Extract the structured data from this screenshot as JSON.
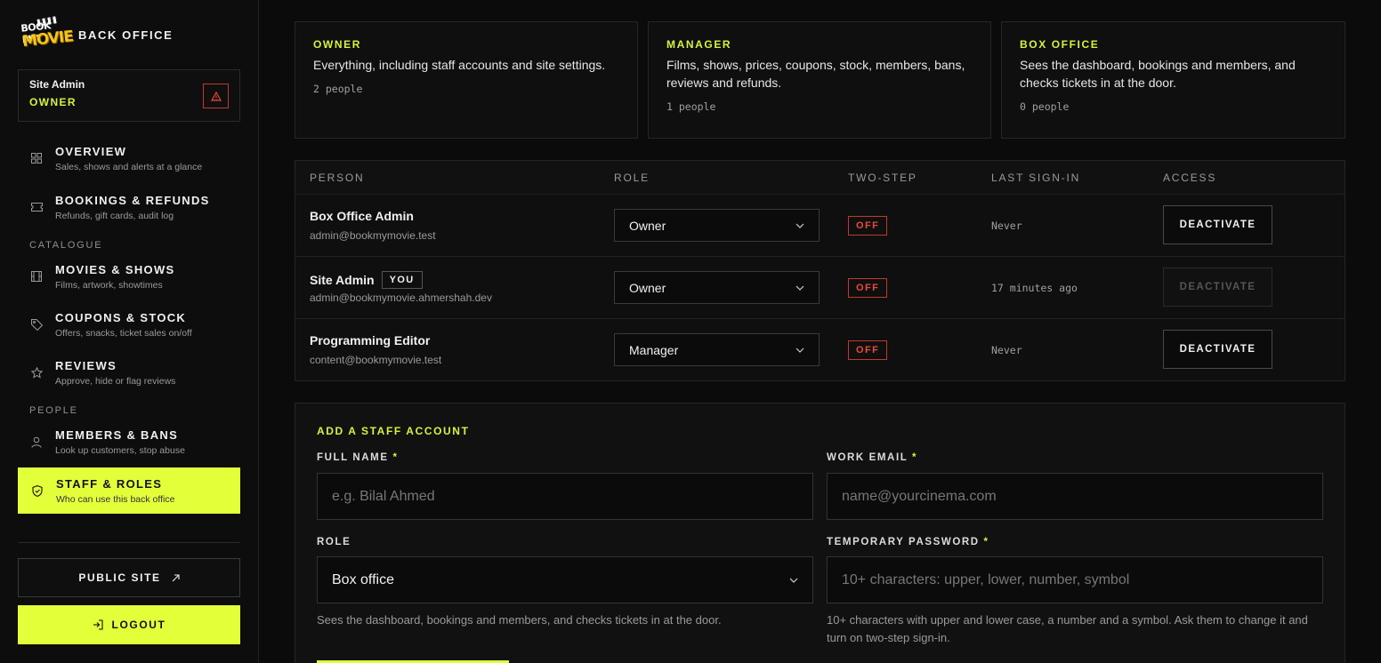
{
  "brand": {
    "logo_top": "BOOK MY",
    "logo_bottom": "MOVIE",
    "title": "BACK OFFICE"
  },
  "user": {
    "name": "Site Admin",
    "role": "OWNER"
  },
  "nav": {
    "overview": {
      "title": "OVERVIEW",
      "sub": "Sales, shows and alerts at a glance"
    },
    "bookings": {
      "title": "BOOKINGS & REFUNDS",
      "sub": "Refunds, gift cards, audit log"
    },
    "catalogue_label": "CATALOGUE",
    "movies": {
      "title": "MOVIES & SHOWS",
      "sub": "Films, artwork, showtimes"
    },
    "coupons": {
      "title": "COUPONS & STOCK",
      "sub": "Offers, snacks, ticket sales on/off"
    },
    "reviews": {
      "title": "REVIEWS",
      "sub": "Approve, hide or flag reviews"
    },
    "people_label": "PEOPLE",
    "members": {
      "title": "MEMBERS & BANS",
      "sub": "Look up customers, stop abuse"
    },
    "staff": {
      "title": "STAFF & ROLES",
      "sub": "Who can use this back office"
    }
  },
  "public_site": "PUBLIC SITE",
  "logout": "LOGOUT",
  "roles": [
    {
      "title": "OWNER",
      "desc": "Everything, including staff accounts and site settings.",
      "count": "2 people"
    },
    {
      "title": "MANAGER",
      "desc": "Films, shows, prices, coupons, stock, members, bans, reviews and refunds.",
      "count": "1 people"
    },
    {
      "title": "BOX OFFICE",
      "desc": "Sees the dashboard, bookings and members, and checks tickets in at the door.",
      "count": "0 people"
    }
  ],
  "table": {
    "headers": {
      "person": "PERSON",
      "role": "ROLE",
      "two_step": "TWO-STEP",
      "last_sign_in": "LAST SIGN-IN",
      "access": "ACCESS"
    },
    "rows": [
      {
        "name": "Box Office Admin",
        "email": "admin@bookmymovie.test",
        "role": "Owner",
        "two_step": "OFF",
        "last": "Never",
        "action": "DEACTIVATE"
      },
      {
        "name": "Site Admin",
        "you": "YOU",
        "email": "admin@bookmymovie.ahmershah.dev",
        "role": "Owner",
        "two_step": "OFF",
        "last": "17 minutes ago",
        "action": "DEACTIVATE"
      },
      {
        "name": "Programming Editor",
        "email": "content@bookmymovie.test",
        "role": "Manager",
        "two_step": "OFF",
        "last": "Never",
        "action": "DEACTIVATE"
      }
    ]
  },
  "form": {
    "title": "ADD A STAFF ACCOUNT",
    "full_name_label": "FULL NAME",
    "full_name_placeholder": "e.g. Bilal Ahmed",
    "email_label": "WORK EMAIL",
    "email_placeholder": "name@yourcinema.com",
    "role_label": "ROLE",
    "role_value": "Box office",
    "role_help": "Sees the dashboard, bookings and members, and checks tickets in at the door.",
    "password_label": "TEMPORARY PASSWORD",
    "password_placeholder": "10+ characters: upper, lower, number, symbol",
    "password_help": "10+ characters with upper and lower case, a number and a symbol. Ask them to change it and turn on two-step sign-in.",
    "required_mark": "*"
  },
  "colors": {
    "accent": "#e3ff3a",
    "danger": "#e74c3c",
    "background": "#0b0b0b"
  }
}
